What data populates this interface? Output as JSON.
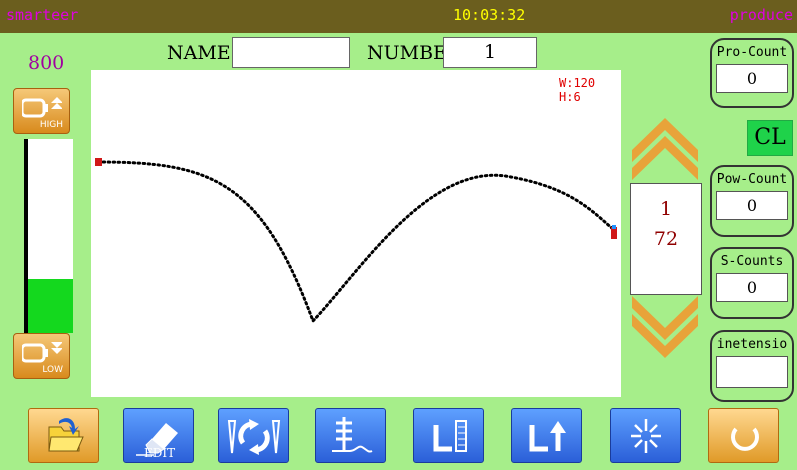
{
  "header": {
    "brand": "smarteer",
    "time": "10:03:32",
    "mode": "produce"
  },
  "speed": {
    "value": "800",
    "high_label": "HIGH",
    "low_label": "LOW",
    "level": 0.28
  },
  "fields": {
    "name_label": "NAME",
    "name_value": "",
    "number_label": "NUMBER",
    "number_value": "1"
  },
  "pattern": {
    "width_label": "W:120",
    "height_label": "H:6"
  },
  "stitch": {
    "current": "1",
    "total": "72"
  },
  "counters": {
    "pro": {
      "title": "Pro-Count",
      "value": "0"
    },
    "clear_label": "CL",
    "pow": {
      "title": "Pow-Count",
      "value": "0"
    },
    "s": {
      "title": "S-Counts",
      "value": "0"
    },
    "tension": {
      "title": "inetensio",
      "value": ""
    }
  },
  "toolbar": {
    "open_icon": "folder-open-icon",
    "edit_label": "EDIT",
    "edit_icon": "eraser-icon",
    "needle_icon": "needle-rotate-icon",
    "thread_icon": "thread-feed-icon",
    "clamp_icon": "clamp-icon",
    "clamp_up_icon": "clamp-up-icon",
    "light_icon": "light-icon",
    "back_icon": "return-icon"
  },
  "colors": {
    "bg": "#a6ee8a",
    "topbar": "#6b5e1e",
    "accent": "#e000e0",
    "time": "#ffff00",
    "speed_fill": "#14d81e"
  }
}
